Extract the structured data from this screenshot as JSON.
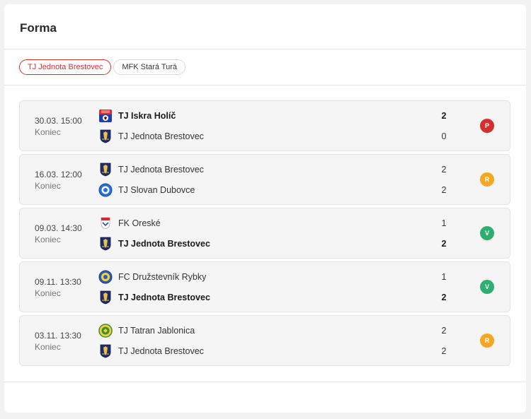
{
  "title": "Forma",
  "tabs": [
    {
      "label": "TJ Jednota Brestovec",
      "active": true
    },
    {
      "label": "MFK Stará Turá",
      "active": false
    }
  ],
  "colors": {
    "accent": "#d32f2f",
    "loss": "#d32f2f",
    "draw": "#f5a623",
    "win": "#2eaf6f"
  },
  "matches": [
    {
      "date": "30.03. 15:00",
      "status": "Koniec",
      "home": {
        "name": "TJ Iskra Holíč",
        "crest": "iskra-holic-crest",
        "score": "2",
        "winner": true
      },
      "away": {
        "name": "TJ Jednota Brestovec",
        "crest": "jednota-brestovec-crest",
        "score": "0",
        "winner": false
      },
      "result": "P",
      "result_type": "loss"
    },
    {
      "date": "16.03. 12:00",
      "status": "Koniec",
      "home": {
        "name": "TJ Jednota Brestovec",
        "crest": "jednota-brestovec-crest",
        "score": "2",
        "winner": false
      },
      "away": {
        "name": "TJ Slovan Dubovce",
        "crest": "slovan-dubovce-crest",
        "score": "2",
        "winner": false
      },
      "result": "R",
      "result_type": "draw"
    },
    {
      "date": "09.03. 14:30",
      "status": "Koniec",
      "home": {
        "name": "FK Oreské",
        "crest": "fk-oreske-crest",
        "score": "1",
        "winner": false
      },
      "away": {
        "name": "TJ Jednota Brestovec",
        "crest": "jednota-brestovec-crest",
        "score": "2",
        "winner": true
      },
      "result": "V",
      "result_type": "win"
    },
    {
      "date": "09.11. 13:30",
      "status": "Koniec",
      "home": {
        "name": "FC Družstevník Rybky",
        "crest": "druzstevnik-rybky-crest",
        "score": "1",
        "winner": false
      },
      "away": {
        "name": "TJ Jednota Brestovec",
        "crest": "jednota-brestovec-crest",
        "score": "2",
        "winner": true
      },
      "result": "V",
      "result_type": "win"
    },
    {
      "date": "03.11. 13:30",
      "status": "Koniec",
      "home": {
        "name": "TJ Tatran Jablonica",
        "crest": "tatran-jablonica-crest",
        "score": "2",
        "winner": false
      },
      "away": {
        "name": "TJ Jednota Brestovec",
        "crest": "jednota-brestovec-crest",
        "score": "2",
        "winner": false
      },
      "result": "R",
      "result_type": "draw"
    }
  ]
}
